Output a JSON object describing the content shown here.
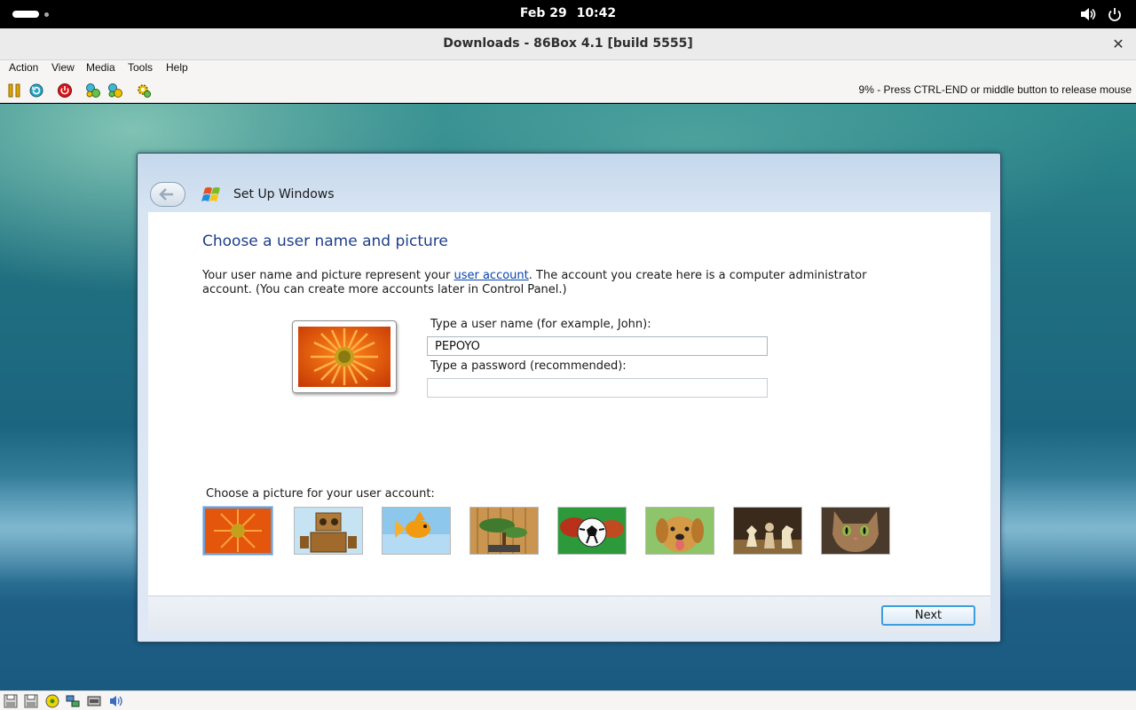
{
  "topbar": {
    "date": "Feb 29",
    "time": "10:42",
    "icons": [
      "volume-icon",
      "power-icon"
    ]
  },
  "window": {
    "title": "Downloads - 86Box 4.1 [build 5555]",
    "close_icon": "close-icon"
  },
  "menubar": {
    "items": [
      {
        "label": "Action"
      },
      {
        "label": "View"
      },
      {
        "label": "Media"
      },
      {
        "label": "Tools"
      },
      {
        "label": "Help"
      }
    ]
  },
  "toolbar": {
    "icons": [
      "pause-icon",
      "reset-icon",
      "power-off-icon",
      "ctrl-alt-del-icon",
      "ctrl-alt-esc-icon",
      "settings-icon"
    ],
    "status_message": "9% - Press CTRL-END or middle button to release mouse"
  },
  "setup": {
    "title": "Set Up Windows",
    "heading": "Choose a user name and picture",
    "intro_before": "Your user name and picture represent your ",
    "intro_link": "user account",
    "intro_after": ". The account you create here is a computer administrator account. (You can create more accounts later in Control Panel.)",
    "username_label": "Type a user name (for example, John):",
    "username_value": "PEPOYO",
    "password_label": "Type a password (recommended):",
    "password_value": "",
    "picture_label": "Choose a picture for your user account:",
    "pictures": [
      "flower",
      "robot",
      "fish",
      "bonsai",
      "soccer-ball",
      "dog",
      "chess",
      "cat"
    ],
    "selected_picture": "flower",
    "next_label": "Next"
  },
  "statusbar": {
    "icons": [
      "floppy-drive-icon",
      "floppy-drive-icon",
      "cdrom-icon",
      "network-icon",
      "hard-disk-icon",
      "sound-icon"
    ]
  },
  "colors": {
    "heading_blue": "#1e3e8a",
    "link_blue": "#0645ad",
    "next_border": "#3c9ede"
  }
}
